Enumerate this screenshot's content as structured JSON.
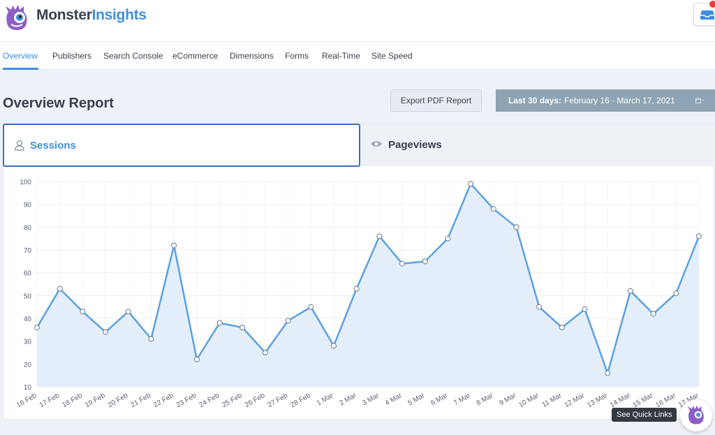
{
  "brand": {
    "part1": "Monster",
    "part2": "Insights"
  },
  "nav": {
    "tabs": [
      {
        "label": "Overview"
      },
      {
        "label": "Publishers"
      },
      {
        "label": "Search Console"
      },
      {
        "label": "eCommerce"
      },
      {
        "label": "Dimensions"
      },
      {
        "label": "Forms"
      },
      {
        "label": "Real-Time"
      },
      {
        "label": "Site Speed"
      }
    ]
  },
  "report": {
    "title": "Overview Report",
    "export_label": "Export PDF Report",
    "date_prefix": "Last 30 days:",
    "date_range": "February 16 - March 17, 2021"
  },
  "metric_tabs": {
    "sessions": "Sessions",
    "pageviews": "Pageviews"
  },
  "quick_links": "See Quick Links",
  "colors": {
    "accent": "#3d8ede",
    "line": "#5aa1e3",
    "area": "#e4eefa",
    "date_button": "#8ea4b4"
  },
  "chart_data": {
    "type": "area",
    "x": [
      "16 Feb",
      "17 Feb",
      "18 Feb",
      "19 Feb",
      "20 Feb",
      "21 Feb",
      "22 Feb",
      "23 Feb",
      "24 Feb",
      "25 Feb",
      "26 Feb",
      "27 Feb",
      "28 Feb",
      "1 Mar",
      "2 Mar",
      "3 Mar",
      "4 Mar",
      "5 Mar",
      "6 Mar",
      "7 Mar",
      "8 Mar",
      "9 Mar",
      "10 Mar",
      "11 Mar",
      "12 Mar",
      "13 Mar",
      "14 Mar",
      "15 Mar",
      "16 Mar",
      "17 Mar"
    ],
    "series": [
      {
        "values": [
          36,
          53,
          43,
          34,
          43,
          31,
          72,
          22,
          38,
          36,
          25,
          39,
          45,
          28,
          53,
          76,
          64,
          65,
          75,
          99,
          88,
          80,
          45,
          36,
          44,
          16,
          52,
          42,
          51,
          76
        ]
      }
    ],
    "yticks": [
      10,
      20,
      30,
      40,
      50,
      60,
      70,
      80,
      90,
      100
    ],
    "ylim": [
      10,
      100
    ],
    "grid": true
  }
}
